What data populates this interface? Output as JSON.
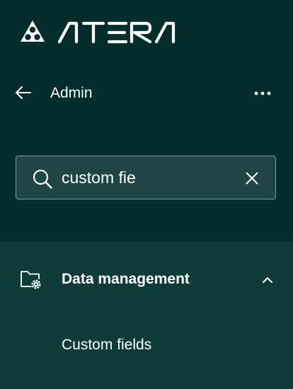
{
  "brand": {
    "logo_text": "ATERA"
  },
  "header": {
    "back_icon": "arrow-left-icon",
    "title": "Admin",
    "more_icon": "more-horizontal-icon"
  },
  "search": {
    "value": "custom fie",
    "search_icon": "search-icon",
    "clear_icon": "close-icon"
  },
  "results": {
    "sections": [
      {
        "label": "Data management",
        "icon": "folder-settings-icon",
        "expanded": true,
        "items": [
          {
            "label": "Custom fields"
          }
        ]
      }
    ]
  },
  "colors": {
    "background": "#032e2d",
    "results_background": "#0f3b39",
    "search_background": "#1f4644",
    "search_border": "#7aa09e",
    "text": "#ffffff"
  }
}
